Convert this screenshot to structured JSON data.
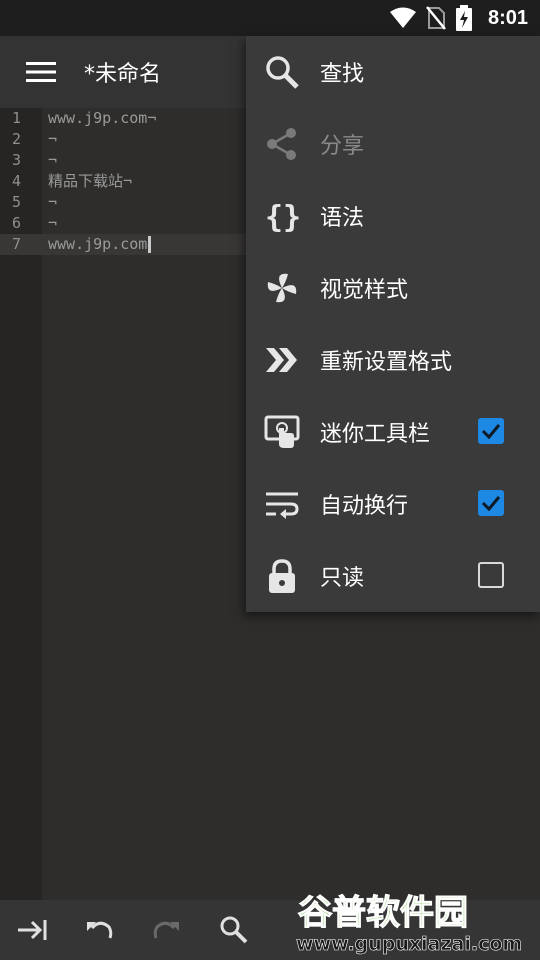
{
  "status": {
    "time": "8:01",
    "icons": [
      "wifi-icon",
      "no-sim-icon",
      "battery-charging-icon"
    ]
  },
  "toolbar": {
    "title": "*未命名",
    "menu_icon": "hamburger-menu-icon"
  },
  "editor": {
    "lines": [
      {
        "num": "1",
        "text": "www.j9p.com¬"
      },
      {
        "num": "2",
        "text": "¬"
      },
      {
        "num": "3",
        "text": "¬"
      },
      {
        "num": "4",
        "text": "精品下载站¬"
      },
      {
        "num": "5",
        "text": "¬"
      },
      {
        "num": "6",
        "text": "¬"
      },
      {
        "num": "7",
        "text": "www.j9p.com"
      }
    ],
    "current_line": 7
  },
  "menu": {
    "items": [
      {
        "label": "查找",
        "icon": "search-icon",
        "enabled": true
      },
      {
        "label": "分享",
        "icon": "share-icon",
        "enabled": false
      },
      {
        "label": "语法",
        "icon": "braces-icon",
        "enabled": true
      },
      {
        "label": "视觉样式",
        "icon": "pinwheel-icon",
        "enabled": true
      },
      {
        "label": "重新设置格式",
        "icon": "double-chevron-icon",
        "enabled": true
      },
      {
        "label": "迷你工具栏",
        "icon": "touch-screen-icon",
        "enabled": true,
        "checked": true
      },
      {
        "label": "自动换行",
        "icon": "wrap-text-icon",
        "enabled": true,
        "checked": true
      },
      {
        "label": "只读",
        "icon": "lock-icon",
        "enabled": true,
        "checked": false
      }
    ]
  },
  "bottombar": {
    "icons": [
      "tab-indent-icon",
      "undo-icon",
      "redo-icon",
      "search-icon"
    ]
  },
  "watermark": {
    "line1": "谷普软件园",
    "line2": "www.gupuxiazai.com"
  },
  "colors": {
    "accent": "#1e88e5",
    "popup_bg": "#3a3a3a",
    "toolbar_bg": "#333333",
    "editor_bg": "#2e2d2c"
  }
}
